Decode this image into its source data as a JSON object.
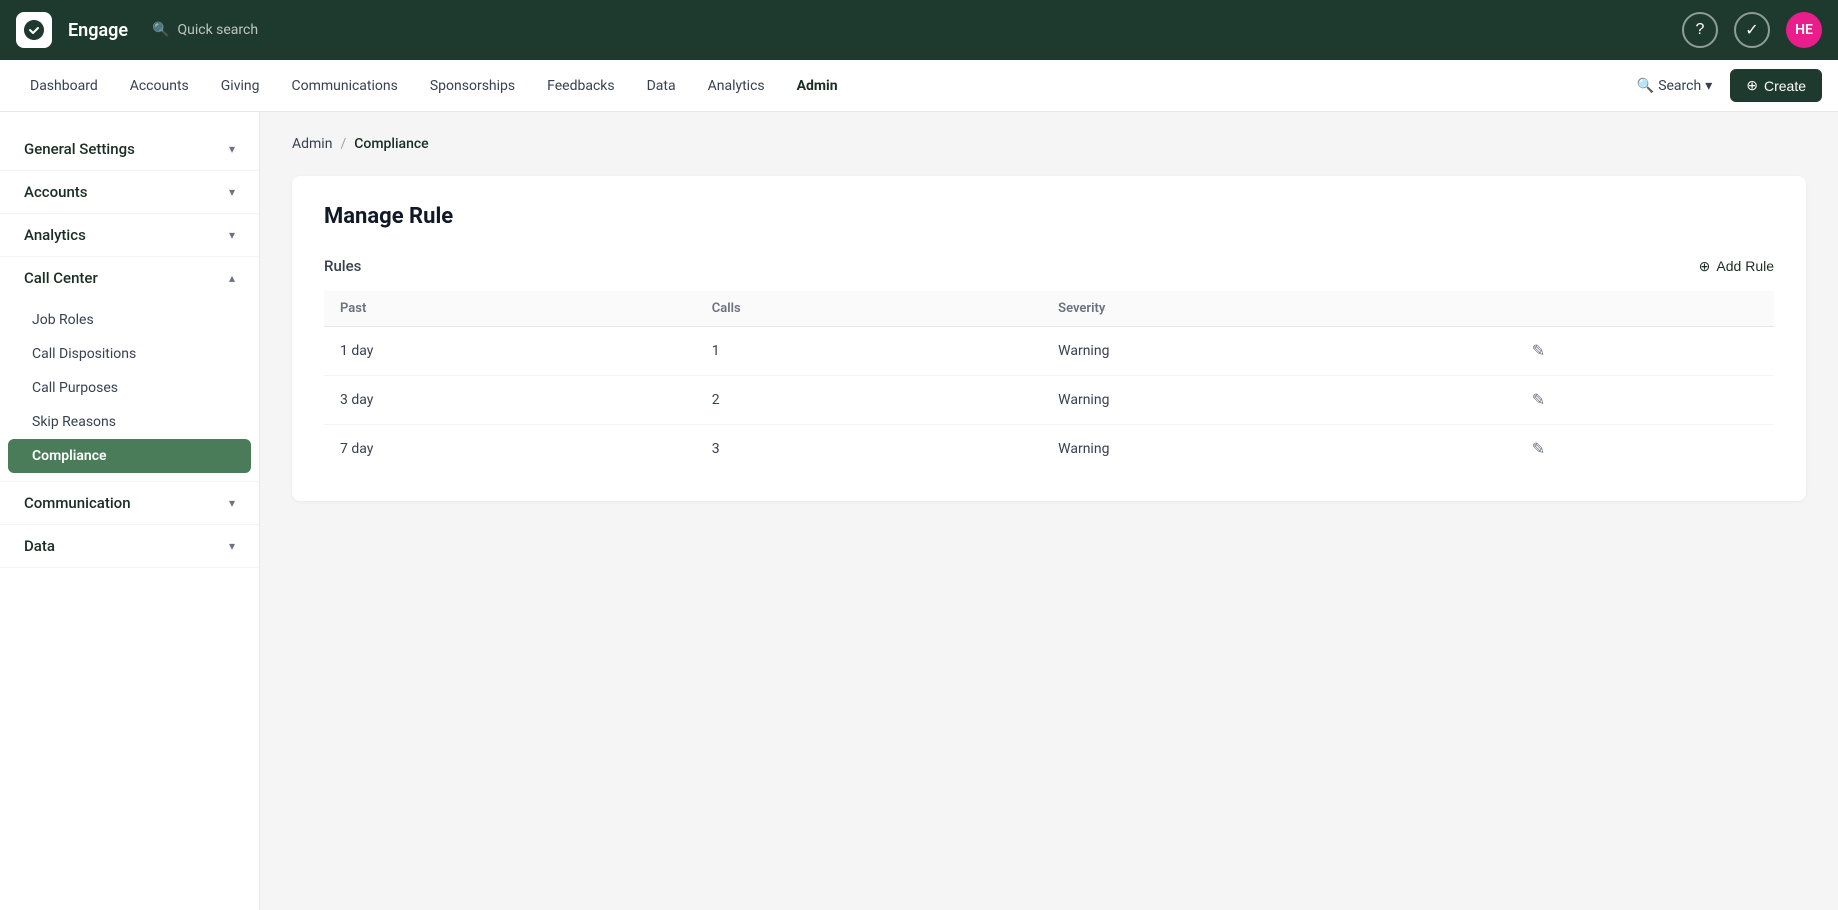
{
  "topbar": {
    "logo_alt": "Engage logo",
    "app_title": "Engage",
    "search_placeholder": "Quick search",
    "help_icon": "?",
    "task_icon": "✓",
    "avatar_initials": "HE",
    "avatar_color": "#e91e8c"
  },
  "navbar": {
    "items": [
      {
        "label": "Dashboard",
        "active": false
      },
      {
        "label": "Accounts",
        "active": false
      },
      {
        "label": "Giving",
        "active": false
      },
      {
        "label": "Communications",
        "active": false
      },
      {
        "label": "Sponsorships",
        "active": false
      },
      {
        "label": "Feedbacks",
        "active": false
      },
      {
        "label": "Data",
        "active": false
      },
      {
        "label": "Analytics",
        "active": false
      },
      {
        "label": "Admin",
        "active": true
      }
    ],
    "search_label": "Search",
    "create_label": "Create"
  },
  "breadcrumb": {
    "parent": "Admin",
    "separator": "/",
    "current": "Compliance"
  },
  "sidebar": {
    "sections": [
      {
        "label": "General Settings",
        "expanded": false,
        "children": []
      },
      {
        "label": "Accounts",
        "expanded": false,
        "children": []
      },
      {
        "label": "Analytics",
        "expanded": false,
        "children": []
      },
      {
        "label": "Call Center",
        "expanded": true,
        "children": [
          {
            "label": "Job Roles",
            "active": false
          },
          {
            "label": "Call Dispositions",
            "active": false
          },
          {
            "label": "Call Purposes",
            "active": false
          },
          {
            "label": "Skip Reasons",
            "active": false
          },
          {
            "label": "Compliance",
            "active": true
          }
        ]
      },
      {
        "label": "Communication",
        "expanded": false,
        "children": []
      },
      {
        "label": "Data",
        "expanded": false,
        "children": []
      }
    ]
  },
  "manage_rule": {
    "title": "Manage Rule",
    "rules_label": "Rules",
    "add_rule_label": "Add Rule",
    "table": {
      "columns": [
        "Past",
        "Calls",
        "Severity"
      ],
      "rows": [
        {
          "past": "1 day",
          "calls": "1",
          "severity": "Warning"
        },
        {
          "past": "3 day",
          "calls": "2",
          "severity": "Warning"
        },
        {
          "past": "7 day",
          "calls": "3",
          "severity": "Warning"
        }
      ]
    }
  }
}
